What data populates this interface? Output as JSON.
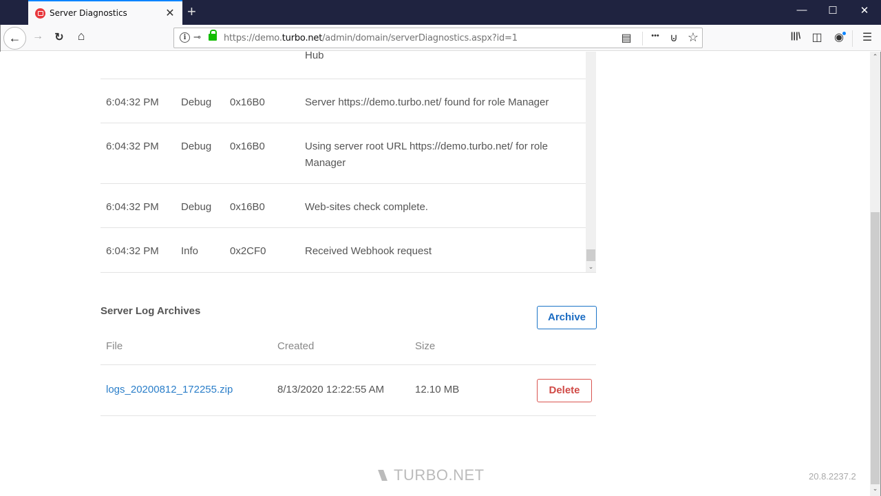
{
  "browser": {
    "tab_title": "Server Diagnostics",
    "tab_close": "✕",
    "new_tab": "+",
    "window_controls": {
      "minimize": "—",
      "maximize": "☐",
      "close": "✕"
    },
    "url": {
      "prefix": "https://demo.",
      "domain": "turbo.net",
      "path": "/admin/domain/serverDiagnostics.aspx?id=1"
    },
    "icons": {
      "back": "←",
      "forward": "→",
      "reload": "↻",
      "home": "⌂",
      "info": "i",
      "key": "⊸",
      "reader": "▤",
      "more": "•••",
      "pocket": "⊍",
      "star": "☆",
      "library": "|||\\",
      "sidebar": "◫",
      "account": "◉",
      "menu": "☰"
    }
  },
  "log": {
    "rows": [
      {
        "time": "",
        "level": "",
        "thread": "",
        "message": "Hub"
      },
      {
        "time": "6:04:32 PM",
        "level": "Debug",
        "thread": "0x16B0",
        "message": "Server https://demo.turbo.net/ found for role Manager"
      },
      {
        "time": "6:04:32 PM",
        "level": "Debug",
        "thread": "0x16B0",
        "message": "Using server root URL https://demo.turbo.net/ for role Manager"
      },
      {
        "time": "6:04:32 PM",
        "level": "Debug",
        "thread": "0x16B0",
        "message": "Web-sites check complete."
      },
      {
        "time": "6:04:32 PM",
        "level": "Info",
        "thread": "0x2CF0",
        "message": "Received Webhook request"
      }
    ],
    "scroll_down": "⌄"
  },
  "archives": {
    "title": "Server Log Archives",
    "archive_button": "Archive",
    "columns": {
      "file": "File",
      "created": "Created",
      "size": "Size"
    },
    "rows": [
      {
        "file": "logs_20200812_172255.zip",
        "created": "8/13/2020 12:22:55 AM",
        "size": "12.10 MB",
        "delete": "Delete"
      }
    ]
  },
  "footer": {
    "logo": "TURBO.NET",
    "version": "20.8.2237.2"
  },
  "scrollbar": {
    "up": "⌃",
    "down": "⌄"
  },
  "colors": {
    "accent": "#1a6bc2",
    "danger": "#d04a46",
    "titlebar": "#1f2340",
    "link": "#2a7ec9"
  }
}
